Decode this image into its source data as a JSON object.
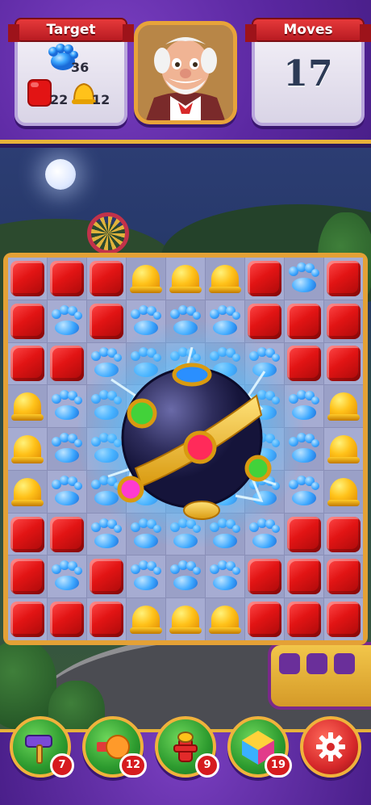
{
  "hud": {
    "target_label": "Target",
    "moves_label": "Moves",
    "moves_left": "17",
    "goals": [
      {
        "icon": "paw-icon",
        "count": "36"
      },
      {
        "icon": "red-block-icon",
        "count": "22"
      },
      {
        "icon": "bell-icon",
        "count": "12"
      }
    ]
  },
  "board": {
    "rows": [
      [
        "block",
        "block",
        "block",
        "bell",
        "bell",
        "bell",
        "block",
        "paw",
        "block"
      ],
      [
        "block",
        "paw",
        "block",
        "paw",
        "paw",
        "paw",
        "block",
        "block",
        "block"
      ],
      [
        "block",
        "block",
        "paw",
        "paw",
        "paw",
        "paw",
        "paw",
        "block",
        "block"
      ],
      [
        "bell",
        "paw",
        "paw",
        "paw",
        "paw",
        "paw",
        "paw",
        "paw",
        "bell"
      ],
      [
        "bell",
        "paw",
        "paw",
        "paw",
        "paw",
        "paw",
        "paw",
        "paw",
        "bell"
      ],
      [
        "bell",
        "paw",
        "paw",
        "paw",
        "paw",
        "paw",
        "paw",
        "paw",
        "bell"
      ],
      [
        "block",
        "block",
        "paw",
        "paw",
        "paw",
        "paw",
        "paw",
        "block",
        "block"
      ],
      [
        "block",
        "paw",
        "block",
        "paw",
        "paw",
        "paw",
        "block",
        "block",
        "block"
      ],
      [
        "block",
        "block",
        "block",
        "bell",
        "bell",
        "bell",
        "block",
        "block",
        "block"
      ]
    ]
  },
  "boosters": [
    {
      "icon": "hammer-icon",
      "count": "7"
    },
    {
      "icon": "boxing-glove-icon",
      "count": "12"
    },
    {
      "icon": "fire-hydrant-icon",
      "count": "9"
    },
    {
      "icon": "color-cube-icon",
      "count": "19"
    }
  ],
  "settings_icon": "gear-icon",
  "colors": {
    "hud_purple": "#5a27a0",
    "ribbon_red": "#d62a2e",
    "board_frame": "#e4a136",
    "block_red": "#e21414",
    "bell_yellow": "#ffc21a",
    "paw_blue": "#3ea8ff",
    "booster_green": "#2c9a2e"
  }
}
